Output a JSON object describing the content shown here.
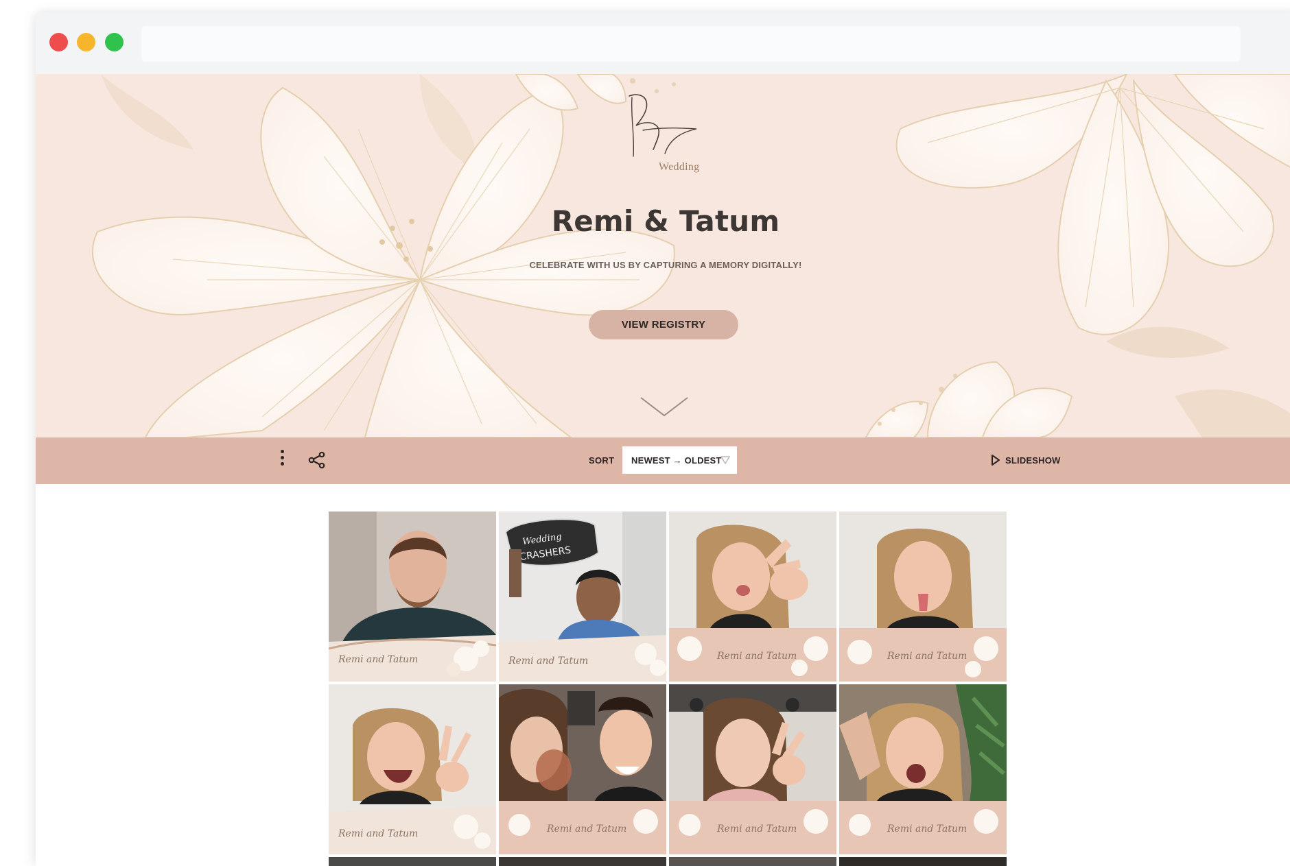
{
  "browser": {
    "window_controls": [
      "close-dot",
      "minimize-dot",
      "maximize-dot"
    ],
    "url": ""
  },
  "hero": {
    "monogram_word": "Wedding",
    "couple_names": "Remi & Tatum",
    "tagline": "CELEBRATE WITH US BY CAPTURING A MEMORY DIGITALLY!",
    "registry_button": "VIEW REGISTRY",
    "background_color": "#f8e7df",
    "accent_color": "#d7b3a5"
  },
  "toolbar": {
    "sort_label": "SORT",
    "sort_value": "NEWEST → OLDEST",
    "slideshow_label": "SLIDESHOW",
    "background_color": "#ddb6a8",
    "icons": [
      "more-vertical-icon",
      "share-icon",
      "dropdown-caret-icon",
      "play-icon"
    ]
  },
  "gallery": {
    "photos": [
      {
        "subject": "man-smiling-selfie",
        "overlay_caption": "Remi and Tatum"
      },
      {
        "subject": "man-holding-wedding-crashers-sign",
        "overlay_caption": "Remi and Tatum"
      },
      {
        "subject": "woman-peace-sign-kissy-face",
        "overlay_caption": "Remi and Tatum"
      },
      {
        "subject": "woman-tongue-out",
        "overlay_caption": "Remi and Tatum"
      },
      {
        "subject": "woman-peace-sign-laughing",
        "overlay_caption": "Remi and Tatum"
      },
      {
        "subject": "couple-toasting-drinks",
        "overlay_caption": "Remi and Tatum"
      },
      {
        "subject": "woman-peace-sign-selfie",
        "overlay_caption": "Remi and Tatum"
      },
      {
        "subject": "woman-excited-by-plant",
        "overlay_caption": "Remi and Tatum"
      }
    ],
    "sign_text": "Wedding CRASHERS"
  }
}
